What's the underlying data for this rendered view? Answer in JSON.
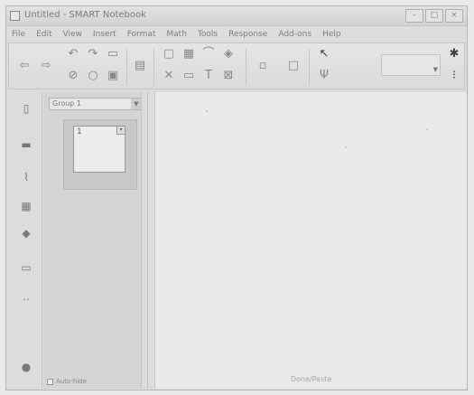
{
  "window": {
    "title": "Untitled - SMART Notebook",
    "buttons": [
      "–",
      "□",
      "×"
    ]
  },
  "menu": [
    "File",
    "Edit",
    "View",
    "Insert",
    "Format",
    "Math",
    "Tools",
    "Response",
    "Add-ons",
    "Help"
  ],
  "toolbar": {
    "icons": [
      "back-arrow-icon",
      "forward-arrow-icon",
      "undo-icon",
      "redo-icon",
      "page-icon",
      "delete-icon",
      "save-icon",
      "screen-shade-icon",
      "full-screen-icon",
      "pen-icon",
      "lines-icon",
      "shapes-icon",
      "text-icon",
      "table-icon",
      "select-icon",
      "settings-icon"
    ],
    "tool_select_value": ""
  },
  "sidebar": {
    "icons": [
      "page-sorter-icon",
      "gallery-icon",
      "attachments-icon",
      "properties-icon",
      "addons-icon",
      "response-icon",
      "more-icon",
      "settings-gear-icon"
    ]
  },
  "sorter": {
    "group_label": "Group 1",
    "page_number": "1",
    "page_caption": "",
    "auto_hide_label": "Auto-hide"
  },
  "canvas": {
    "footer": "Done/Paste"
  }
}
